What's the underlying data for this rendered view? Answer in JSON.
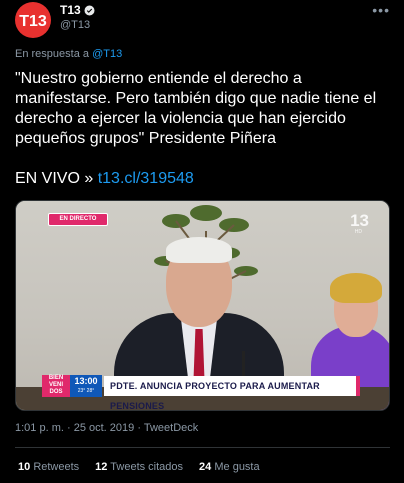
{
  "author": {
    "display_name": "T13",
    "handle": "@T13",
    "avatar_text": "T13",
    "brand_color": "#e8312f",
    "verified": true
  },
  "more_icon": "more-horizontal-icon",
  "reply": {
    "prefix": "En respuesta a",
    "to": "@T13"
  },
  "tweet": {
    "text": "\"Nuestro gobierno entiende el derecho a manifestarse. Pero también digo que nadie tiene el derecho a ejercer la violencia que han ejercido pequeños grupos\" Presidente Piñera",
    "live_prefix": "EN VIVO »",
    "link": "t13.cl/319548"
  },
  "media": {
    "badge": "EN DIRECTO",
    "watermark": "13",
    "watermark_sub": "HD",
    "lower_third": {
      "show_line1": "BIEN",
      "show_line2": "VENI",
      "show_line3": "DOS",
      "time": "13:00",
      "temp": "23° 28°",
      "headline": "PDTE. ANUNCIA PROYECTO PARA AUMENTAR PENSIONES"
    }
  },
  "meta": {
    "time": "1:01 p. m.",
    "date": "25 oct. 2019",
    "source": "TweetDeck",
    "separator": "·"
  },
  "stats": {
    "retweets_count": "10",
    "retweets_label": "Retweets",
    "quotes_count": "12",
    "quotes_label": "Tweets citados",
    "likes_count": "24",
    "likes_label": "Me gusta"
  },
  "colors": {
    "background": "#000000",
    "link": "#1d9bf0",
    "muted": "#8b98a5",
    "accent_pink": "#e0296b"
  }
}
